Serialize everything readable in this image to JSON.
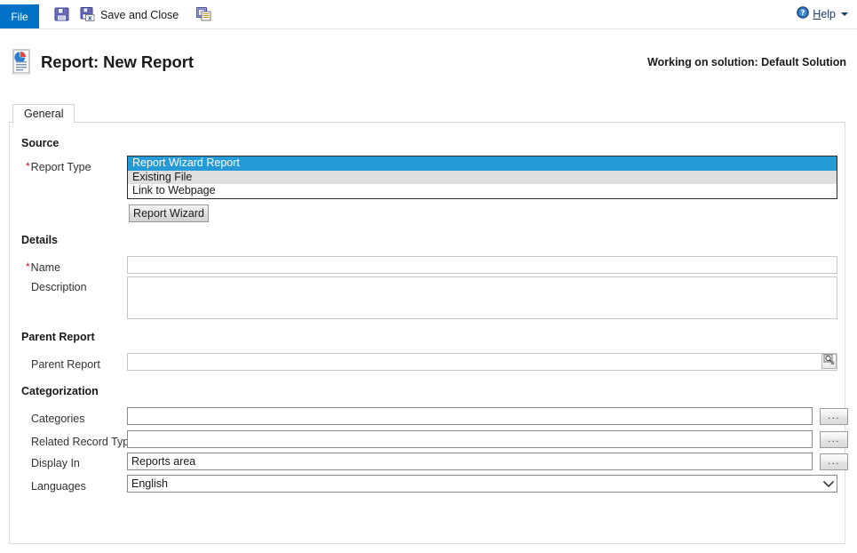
{
  "window": {
    "title": "Report: New Report"
  },
  "commandbar": {
    "file_tab": "File",
    "save_label": "Save",
    "save_icon": "floppy-disk-icon",
    "save_and_close_label": "Save and Close",
    "save_and_close_icon": "save-and-close-icon",
    "save_and_new_label": "Save and New",
    "save_and_new_icon": "save-and-new-icon",
    "help_label": "Help",
    "help_accesskey": "H",
    "help_icon": "help-question-icon",
    "help_caret_icon": "chevron-down-icon",
    "accent_color": "#0072c6"
  },
  "header": {
    "record_icon": "report-document-icon",
    "title": "Report: New Report",
    "solution_note": "Working on solution: Default Solution"
  },
  "tabs": [
    {
      "label": "General",
      "selected": true
    }
  ],
  "form": {
    "sections": {
      "source": {
        "heading": "Source",
        "report_type": {
          "label": "Report Type",
          "required": true,
          "options": [
            {
              "label": "Report Wizard Report",
              "selected": true
            },
            {
              "label": "Existing File",
              "selected": false
            },
            {
              "label": "Link to Webpage",
              "selected": false
            }
          ],
          "selected_value": "Report Wizard Report",
          "selection_color": "#259ad6",
          "alt_row_color": "#dedede"
        },
        "wizard_button": "Report Wizard"
      },
      "details": {
        "heading": "Details",
        "name": {
          "label": "Name",
          "required": true,
          "value": "",
          "placeholder": ""
        },
        "description": {
          "label": "Description",
          "required": false,
          "value": "",
          "placeholder": ""
        }
      },
      "parent_report": {
        "heading": "Parent Report",
        "parent_report": {
          "label": "Parent Report",
          "required": false,
          "value": "",
          "placeholder": "",
          "lookup_icon": "magnifier-lookup-icon"
        }
      },
      "categorization": {
        "heading": "Categorization",
        "categories": {
          "label": "Categories",
          "value": "",
          "placeholder": "",
          "browse_button": "...",
          "browse_icon": "ellipsis-icon"
        },
        "related_record_types": {
          "label": "Related Record Types",
          "value": "",
          "placeholder": "",
          "browse_button": "...",
          "browse_icon": "ellipsis-icon"
        },
        "display_in": {
          "label": "Display In",
          "value": "Reports area",
          "placeholder": "",
          "browse_button": "...",
          "browse_icon": "ellipsis-icon"
        },
        "languages": {
          "label": "Languages",
          "value": "English",
          "options": [
            "English"
          ],
          "caret_icon": "chevron-down-icon"
        }
      }
    },
    "required_marker": "*",
    "required_color": "#c8102e"
  }
}
